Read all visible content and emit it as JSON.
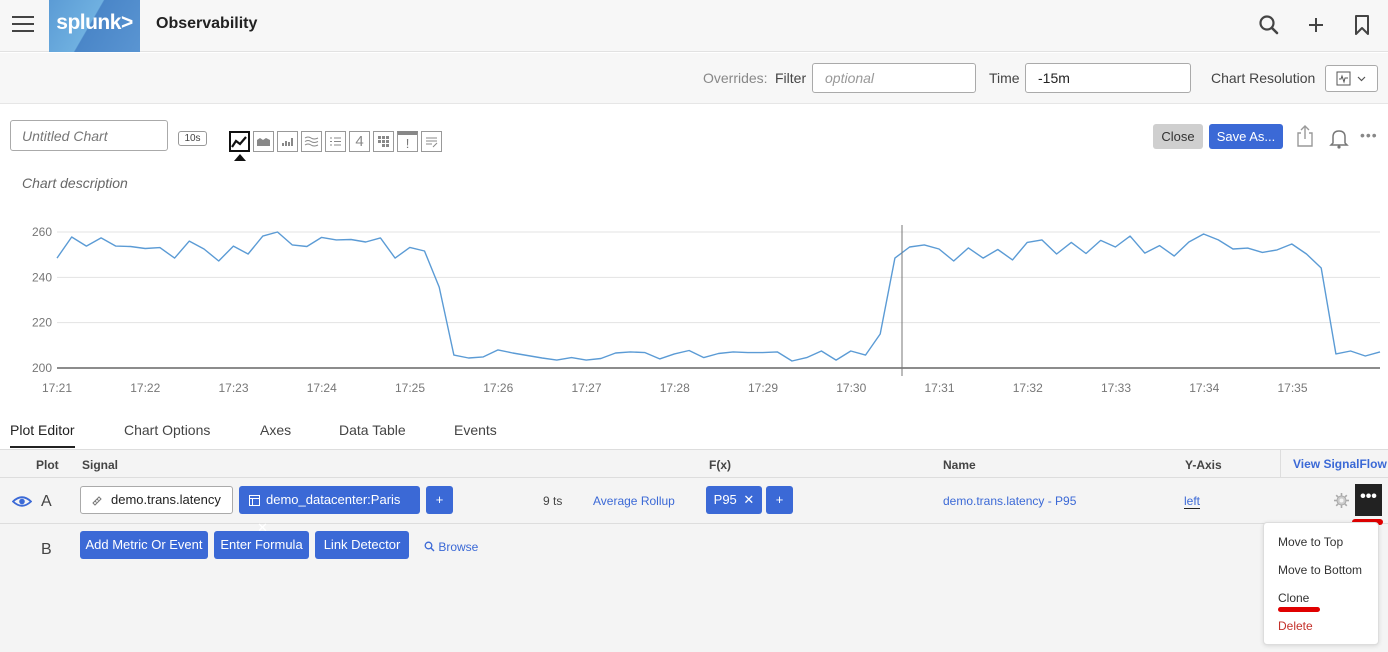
{
  "topbar": {
    "logo_text": "splunk>",
    "app_title": "Observability",
    "icons": [
      "search-icon",
      "plus-icon",
      "bookmark-icon"
    ]
  },
  "overrides": {
    "label": "Overrides:",
    "filter_label": "Filter",
    "filter_placeholder": "optional",
    "time_label": "Time",
    "time_value": "-15m",
    "resolution_label": "Chart Resolution"
  },
  "chart_header": {
    "title_placeholder": "Untitled Chart",
    "resolution_badge": "10s",
    "chart_types": [
      "line",
      "area",
      "column",
      "histogram",
      "list",
      "single-value",
      "heatmap",
      "event-feed",
      "text"
    ],
    "active_chart_type": "line",
    "close_label": "Close",
    "save_as_label": "Save As...",
    "description_placeholder": "Chart description"
  },
  "chart_data": {
    "type": "line",
    "title": "",
    "xlabel": "",
    "ylabel": "",
    "ylim": [
      200,
      262
    ],
    "yticks": [
      200,
      220,
      240,
      260
    ],
    "xticks": [
      "17:21",
      "17:22",
      "17:23",
      "17:24",
      "17:25",
      "17:26",
      "17:27",
      "17:28",
      "17:29",
      "17:30",
      "17:31",
      "17:32",
      "17:33",
      "17:34",
      "17:35"
    ],
    "x_start": "17:21:00",
    "x_interval_seconds": 10,
    "grid": true,
    "crosshair_time": "17:30:35",
    "series": [
      {
        "name": "demo.trans.latency - P95",
        "color": "#5b9bd5",
        "values": [
          248.5,
          257.8,
          253.8,
          257.4,
          253.8,
          253.6,
          252.7,
          253.1,
          248.5,
          256.0,
          252.5,
          247.2,
          253.8,
          250.3,
          258.2,
          260.0,
          254.3,
          253.6,
          257.6,
          256.5,
          256.7,
          255.6,
          257.4,
          248.5,
          253.2,
          251.6,
          235.7,
          205.7,
          204.4,
          204.9,
          208.0,
          206.6,
          205.5,
          204.4,
          203.5,
          204.6,
          203.5,
          204.2,
          206.6,
          207.1,
          206.8,
          204.0,
          206.2,
          207.7,
          204.6,
          206.4,
          207.1,
          206.8,
          206.8,
          207.1,
          203.1,
          204.6,
          207.5,
          203.5,
          207.5,
          205.7,
          215.0,
          248.5,
          253.4,
          254.3,
          252.5,
          247.2,
          253.0,
          248.5,
          252.3,
          247.7,
          255.4,
          256.5,
          250.3,
          255.4,
          250.5,
          256.3,
          253.4,
          258.2,
          250.7,
          254.0,
          249.4,
          255.6,
          259.1,
          256.5,
          252.5,
          252.9,
          251.0,
          252.1,
          254.7,
          250.3,
          244.1,
          206.2,
          207.5,
          205.3,
          207.1
        ]
      }
    ]
  },
  "tabs": [
    {
      "label": "Plot Editor",
      "active": true
    },
    {
      "label": "Chart Options",
      "active": false
    },
    {
      "label": "Axes",
      "active": false
    },
    {
      "label": "Data Table",
      "active": false
    },
    {
      "label": "Events",
      "active": false
    }
  ],
  "plot_editor": {
    "columns": {
      "plot": "Plot",
      "signal": "Signal",
      "fx": "F(x)",
      "name": "Name",
      "yaxis": "Y-Axis"
    },
    "view_signalflow": "View SignalFlow",
    "rows": [
      {
        "letter": "A",
        "visible": true,
        "signal": "demo.trans.latency",
        "filter": "demo_datacenter:Paris",
        "add_filter": "+",
        "ts_count": "9 ts",
        "rollup": "Average Rollup",
        "function": "P95",
        "add_function": "+",
        "name": "demo.trans.latency - P95",
        "yaxis": "left",
        "more": "•••"
      },
      {
        "letter": "B",
        "buttons": [
          "Add Metric Or Event",
          "Enter Formula",
          "Link Detector"
        ],
        "browse": "Browse"
      }
    ]
  },
  "context_menu": {
    "items": [
      {
        "label": "Move to Top",
        "danger": false
      },
      {
        "label": "Move to Bottom",
        "danger": false
      },
      {
        "label": "Clone",
        "danger": false
      },
      {
        "label": "Delete",
        "danger": true
      }
    ],
    "annotation_color": "#e00000"
  }
}
